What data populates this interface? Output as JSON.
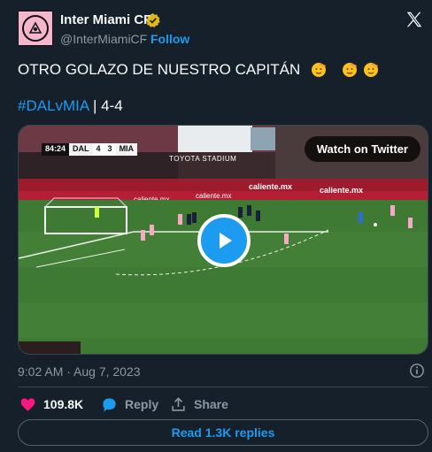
{
  "account": {
    "name": "Inter Miami CF",
    "handle": "@InterMiamiCF",
    "separator": "·",
    "follow_label": "Follow"
  },
  "tweet": {
    "text": "OTRO GOLAZO DE NUESTRO CAPITÁN",
    "emojis": [
      "saluting-face",
      "saluting-face",
      "saluting-face"
    ],
    "hashtag": "#DALvMIA",
    "score_text": "| 4-4"
  },
  "video": {
    "watch_label": "Watch on Twitter",
    "scorebug": {
      "time": "84:24",
      "home_team": "DAL",
      "home_score": "4",
      "away_score": "3",
      "away_team": "MIA"
    },
    "stadium": "TOYOTA STADIUM"
  },
  "meta": {
    "timestamp": "9:02 AM · Aug 7, 2023"
  },
  "actions": {
    "likes": "109.8K",
    "reply_label": "Reply",
    "share_label": "Share"
  },
  "replies_button": "Read 1.3K replies",
  "colors": {
    "background": "#15202b",
    "accent": "#1d9bf0",
    "like": "#f91880",
    "muted": "#8b98a5",
    "brand_pink": "#f5b6cd"
  }
}
